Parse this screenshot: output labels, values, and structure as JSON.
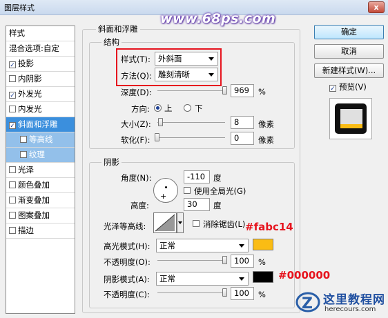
{
  "window": {
    "title": "图层样式",
    "close_label": "x"
  },
  "watermark": "www.68ps.com",
  "left_panel": {
    "header": "样式",
    "items": [
      {
        "label": "混合选项:自定",
        "checkbox": false,
        "checked": false
      },
      {
        "label": "投影",
        "checkbox": true,
        "checked": true
      },
      {
        "label": "内阴影",
        "checkbox": true,
        "checked": false
      },
      {
        "label": "外发光",
        "checkbox": true,
        "checked": true
      },
      {
        "label": "内发光",
        "checkbox": true,
        "checked": false
      },
      {
        "label": "斜面和浮雕",
        "checkbox": true,
        "checked": true,
        "selected": true
      },
      {
        "label": "等高线",
        "checkbox": true,
        "checked": false,
        "sub": true
      },
      {
        "label": "纹理",
        "checkbox": true,
        "checked": false,
        "sub": true
      },
      {
        "label": "光泽",
        "checkbox": true,
        "checked": false
      },
      {
        "label": "颜色叠加",
        "checkbox": true,
        "checked": false
      },
      {
        "label": "渐变叠加",
        "checkbox": true,
        "checked": false
      },
      {
        "label": "图案叠加",
        "checkbox": true,
        "checked": false
      },
      {
        "label": "描边",
        "checkbox": true,
        "checked": false
      }
    ]
  },
  "bevel": {
    "group_title": "斜面和浮雕",
    "structure": {
      "title": "结构",
      "style_label": "样式(T):",
      "style_value": "外斜面",
      "technique_label": "方法(Q):",
      "technique_value": "雕刻清晰",
      "depth_label": "深度(D):",
      "depth_value": "969",
      "depth_unit": "%",
      "depth_slider_fraction": 1.0,
      "direction_label": "方向:",
      "direction_up": "上",
      "direction_down": "下",
      "direction_selected": "上",
      "size_label": "大小(Z):",
      "size_value": "8",
      "size_unit": "像素",
      "size_slider_fraction": 0.05,
      "soften_label": "软化(F):",
      "soften_value": "0",
      "soften_unit": "像素",
      "soften_slider_fraction": 0.0
    },
    "shading": {
      "title": "阴影",
      "angle_label": "角度(N):",
      "angle_value": "-110",
      "angle_unit": "度",
      "global_light_label": "使用全局光(G)",
      "global_light_checked": false,
      "altitude_label": "高度:",
      "altitude_value": "30",
      "altitude_unit": "度",
      "gloss_contour_label": "光泽等高线:",
      "antialias_label": "消除锯齿(L)",
      "antialias_checked": false,
      "highlight_mode_label": "高光模式(H):",
      "highlight_mode_value": "正常",
      "highlight_color": "#fabc14",
      "highlight_opacity_label": "不透明度(O):",
      "highlight_opacity_value": "100",
      "highlight_opacity_unit": "%",
      "highlight_opacity_fraction": 1.0,
      "shadow_mode_label": "阴影模式(A):",
      "shadow_mode_value": "正常",
      "shadow_color": "#000000",
      "shadow_opacity_label": "不透明度(C):",
      "shadow_opacity_value": "100",
      "shadow_opacity_unit": "%",
      "shadow_opacity_fraction": 1.0
    }
  },
  "annotations": {
    "highlight_hex": "#fabc14",
    "shadow_hex": "#000000"
  },
  "buttons": {
    "ok": "确定",
    "cancel": "取消",
    "new_style": "新建样式(W)...",
    "preview_label": "预览(V)",
    "preview_checked": true
  },
  "logo": {
    "text": "这里教程网",
    "url": "herecours.com"
  },
  "colors": {
    "selection": "#3b8fdd",
    "sub_selection": "#93c0ea",
    "annotation_red": "#e6141e"
  }
}
